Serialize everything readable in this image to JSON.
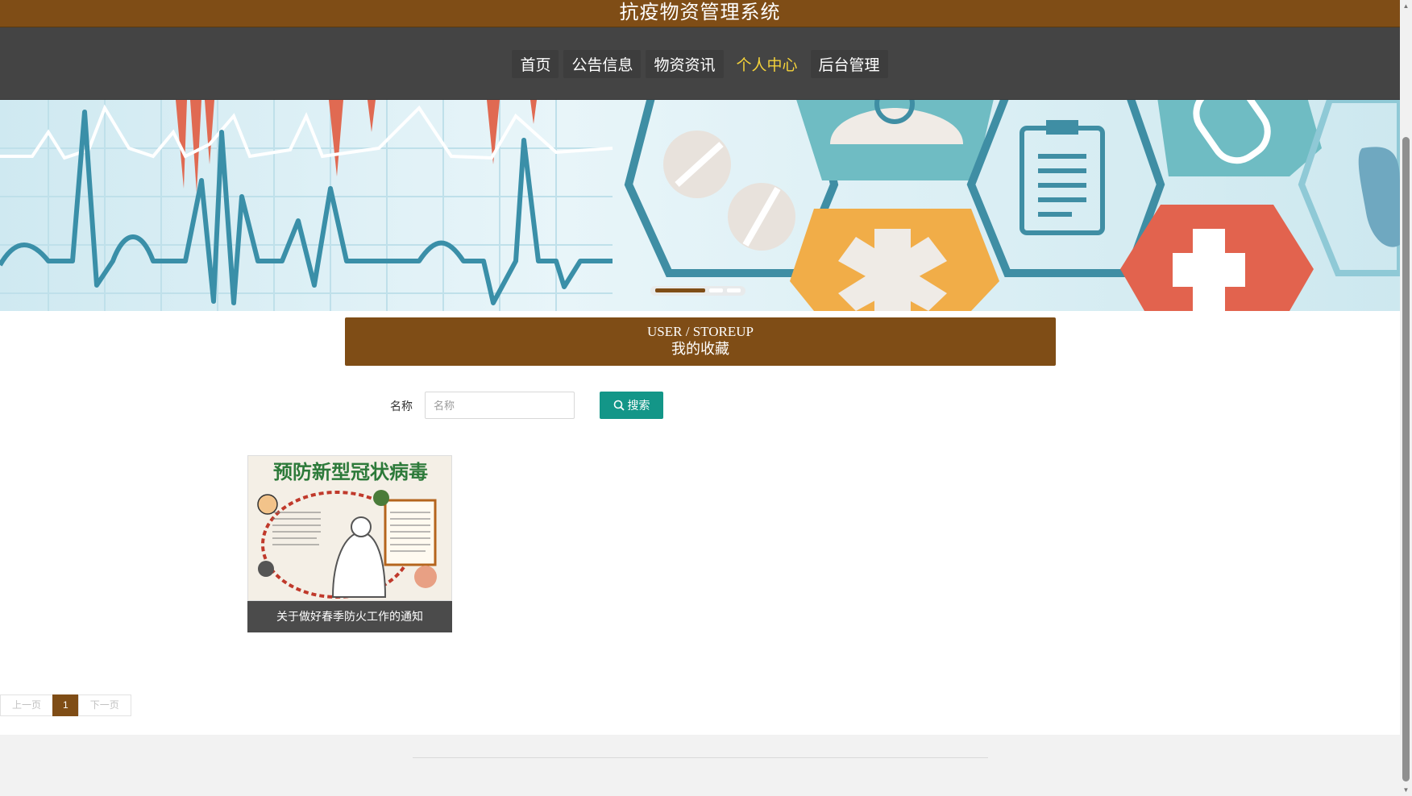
{
  "header": {
    "title": "抗疫物资管理系统"
  },
  "nav": {
    "items": [
      {
        "label": "首页"
      },
      {
        "label": "公告信息"
      },
      {
        "label": "物资资讯"
      },
      {
        "label": "个人中心"
      },
      {
        "label": "后台管理"
      }
    ],
    "active": "个人中心"
  },
  "banner": {
    "slides": 3,
    "active_slide": 1
  },
  "section": {
    "en_title": "USER / STOREUP",
    "cn_title": "我的收藏"
  },
  "search": {
    "label": "名称",
    "placeholder": "名称",
    "value": "",
    "button_label": "搜索"
  },
  "items": [
    {
      "title": "关于做好春季防火工作的通知",
      "image_text": "预防新型冠状病毒"
    }
  ],
  "pagination": {
    "prev_label": "上一页",
    "current_page": "1",
    "next_label": "下一页"
  },
  "colors": {
    "brand": "#7f4d16",
    "nav_bg": "#444444",
    "active_nav": "#f4d23a",
    "search_button": "#139688"
  }
}
